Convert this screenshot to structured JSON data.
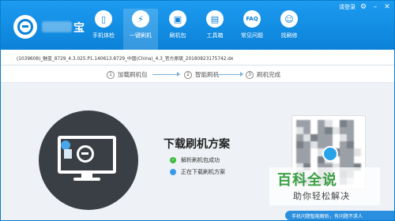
{
  "header": {
    "brand_suffix": "宝",
    "nav": [
      {
        "label": "手机体检",
        "icon": "phone-check-icon",
        "glyph": "▯"
      },
      {
        "label": "一键刷机",
        "icon": "lightning-icon",
        "glyph": "⚡"
      },
      {
        "label": "刷机包",
        "icon": "package-icon",
        "glyph": "▣"
      },
      {
        "label": "工具箱",
        "icon": "toolbox-icon",
        "glyph": "▤"
      },
      {
        "label": "常见问题",
        "icon": "faq-icon",
        "glyph": "FAQ"
      },
      {
        "label": "找刷修",
        "icon": "person-icon",
        "glyph": "☺"
      }
    ],
    "login_label": "请登录"
  },
  "path": {
    "file": "(1039608)_魅蓝_8729_4.3.025.P1.140613.8729_中国(China)_4.3_官方原版_20180823175742.dx"
  },
  "steps": [
    {
      "num": "1",
      "label": "加载刷机包"
    },
    {
      "num": "2",
      "label": "智能刷机"
    },
    {
      "num": "3",
      "label": "刷机完成"
    }
  ],
  "main": {
    "headline": "下载刷机方案",
    "status_items": [
      {
        "label": "解析刷机包成功",
        "state": "done"
      },
      {
        "label": "正在下载刷机方案",
        "state": "progress"
      }
    ]
  },
  "watermark": {
    "title": "百科全说",
    "subtitle": "助你轻松解决"
  },
  "help": {
    "label": "手机问题智能解析，有问题不求人"
  }
}
